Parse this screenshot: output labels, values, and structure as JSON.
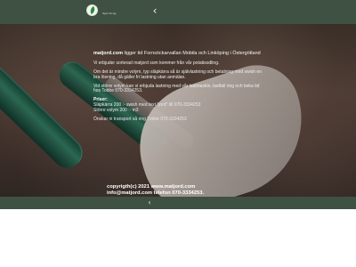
{
  "header": {
    "logo_text": "Sjos hö-ög",
    "nav_chevron_top": "‹"
  },
  "main": {
    "intro_brand": "matjord.com",
    "intro_text": " ligger tid Fornsöckarvallan Mobila och Linköping i Östergötland",
    "paragraph_1": "Vi erbjuder sorterad matjord som kommer från vår potatisodling.",
    "paragraph_2": "Om det är mindre volym, typ släpkärra så är självlastning och betalning med swish en bra lösning, då gäller fri lastning utan anmälan.",
    "paragraph_3": "Vid större volym kan vi erbjuda lastning med vår lastmaskin, lastfall ring och boka tid hos Tobbe 070-3334253.",
    "prices_title": "Priser:",
    "price_1": "Släpkärra 200 :- swish med text \"jord\" till 070-3334253",
    "price_2": "Större volym 200 :- m3",
    "transport_note": "Önskar ni transport så ring Tobbe 070-3334253"
  },
  "footer": {
    "line_1": "copyrigth(c) 2021 www.matjord.com",
    "line_2": "info@matjord.com      telefon 070-3334253."
  },
  "bottom_nav": {
    "chevron": "‹"
  },
  "colors": {
    "topbar": "#3f5143",
    "bottombar": "#3f5143"
  }
}
